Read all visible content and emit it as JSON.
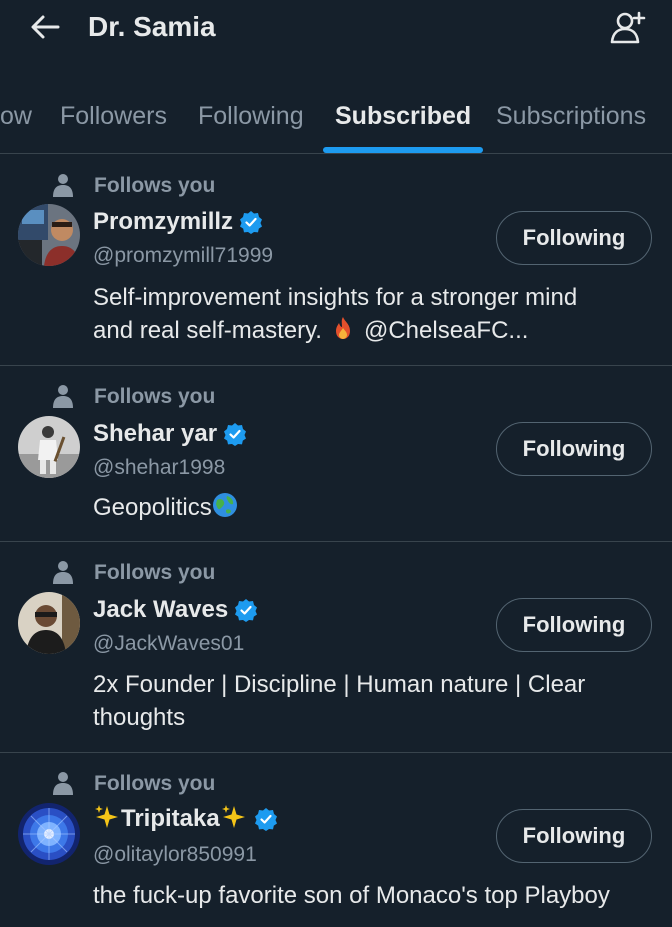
{
  "header": {
    "title": "Dr. Samia",
    "back_icon": "arrow-left-icon",
    "add_icon": "add-user-icon"
  },
  "tabs": [
    {
      "label": "ow"
    },
    {
      "label": "Followers"
    },
    {
      "label": "Following"
    },
    {
      "label": "Subscribed",
      "active": true
    },
    {
      "label": "Subscriptions"
    }
  ],
  "colors": {
    "background": "#15202b",
    "accent": "#1d9bf0",
    "muted": "#8b98a5",
    "divider": "#38444d"
  },
  "users": [
    {
      "follows_label": "Follows you",
      "name": "Promzymillz",
      "handle": "@promzymill71999",
      "bio_lines": [
        "Self-improvement insights for a stronger mind",
        "and real self-mastery.",
        "@ChelseaFC..."
      ],
      "button": "Following"
    },
    {
      "follows_label": "Follows you",
      "name": "Shehar yar",
      "handle": "@shehar1998",
      "bio_lines": [
        "Geopolitics"
      ],
      "button": "Following"
    },
    {
      "follows_label": "Follows you",
      "name": "Jack Waves",
      "handle": "@JackWaves01",
      "bio_lines": [
        "2x Founder | Discipline | Human nature | Clear",
        "thoughts"
      ],
      "button": "Following"
    },
    {
      "follows_label": "Follows you",
      "name": "Tripitaka",
      "handle": "@olitaylor850991",
      "bio_lines": [
        "the fuck-up favorite son of Monaco's top Playboy"
      ],
      "button": "Following"
    }
  ]
}
